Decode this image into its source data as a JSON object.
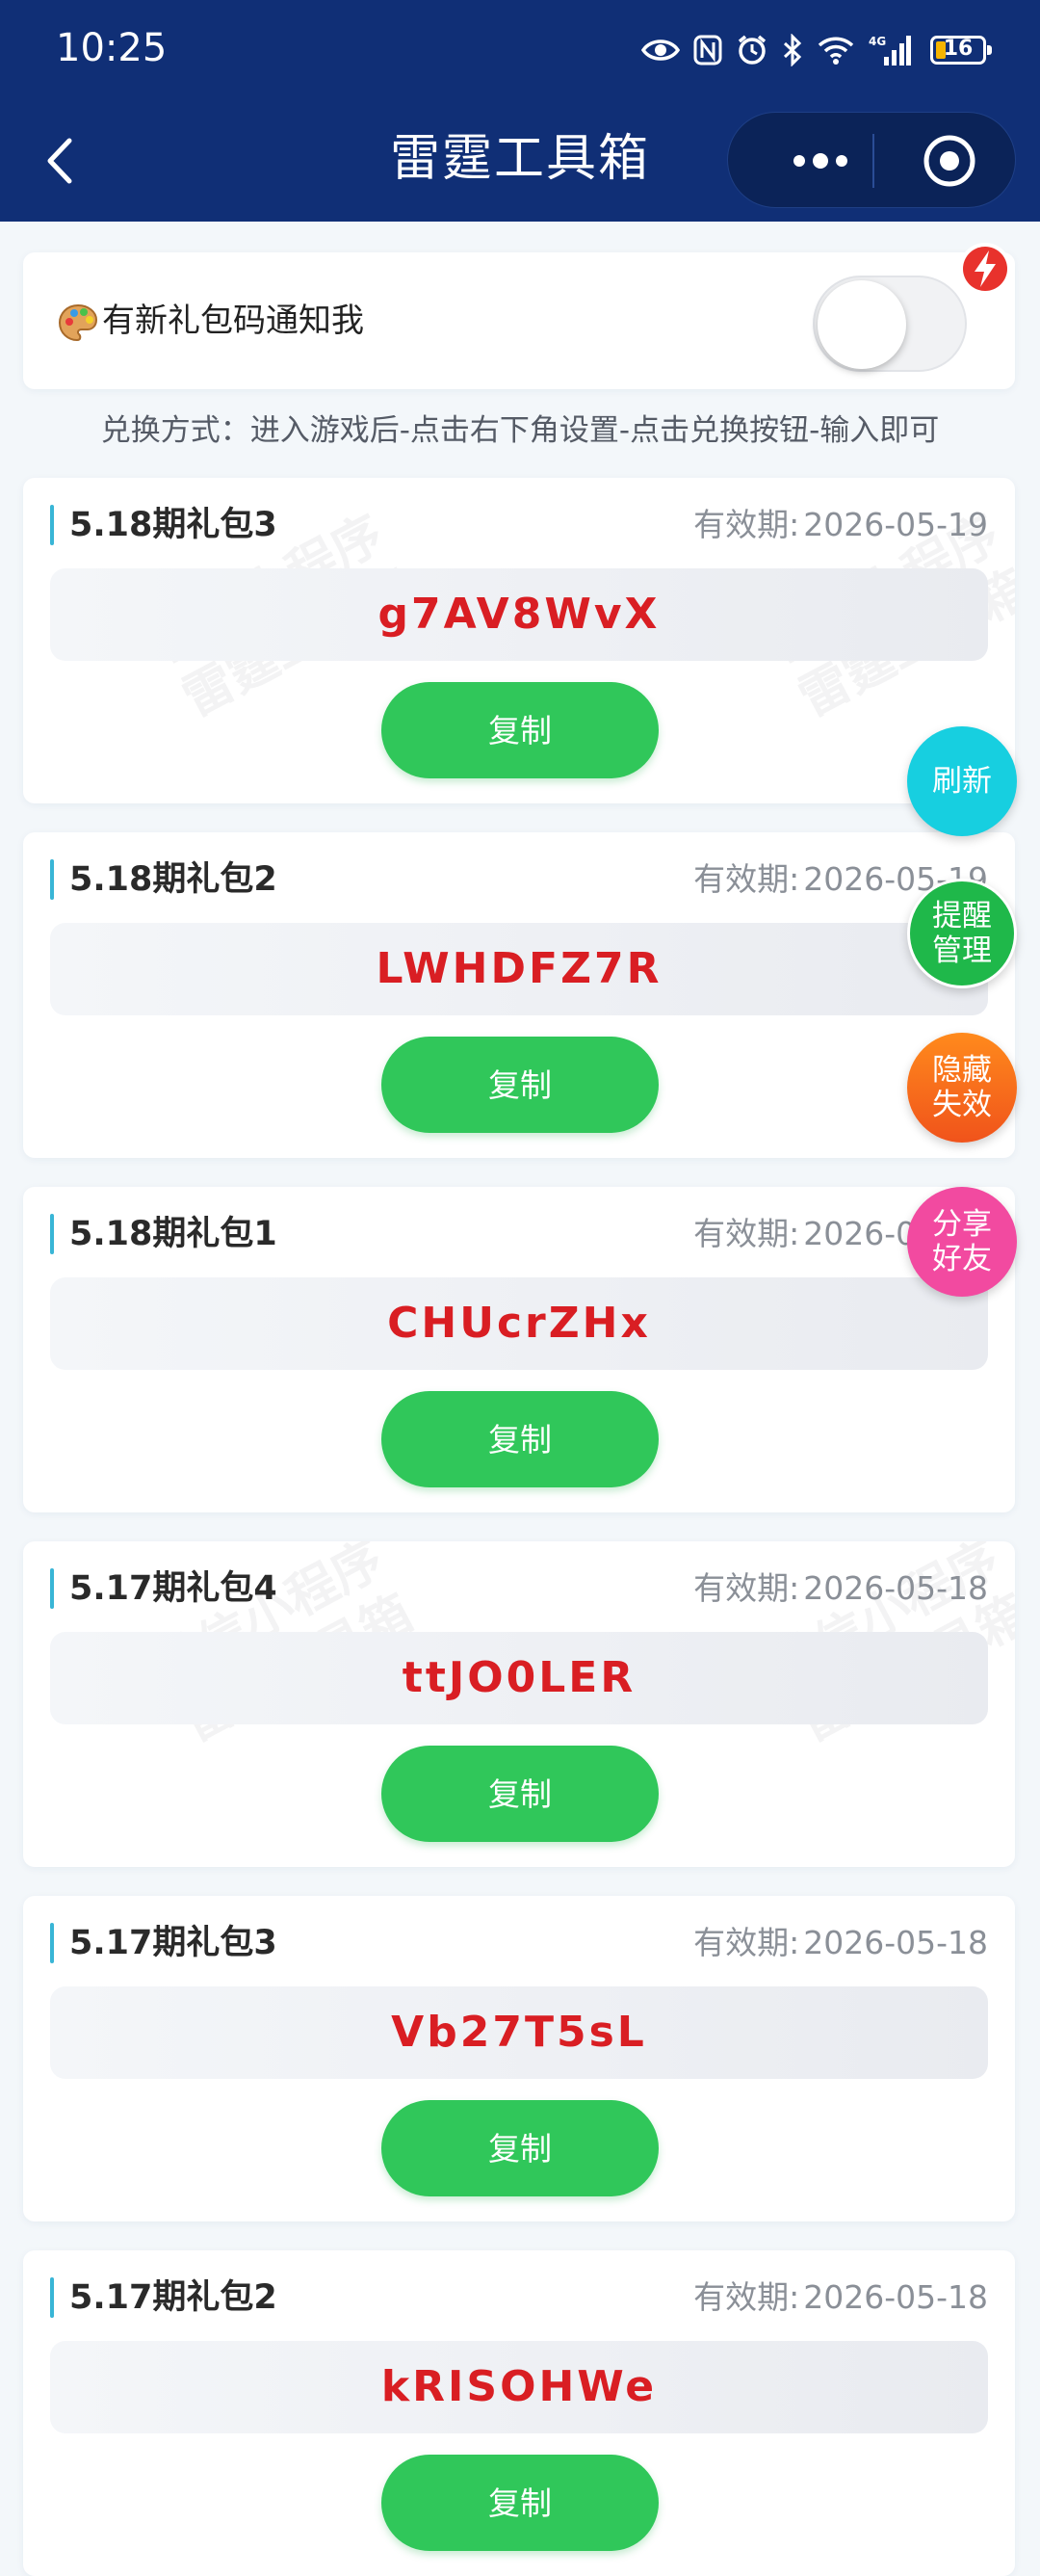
{
  "status_bar": {
    "time": "10:25",
    "battery": "16",
    "icons": [
      "eye-icon",
      "nfc-icon",
      "alarm-icon",
      "bluetooth-icon",
      "wifi-icon",
      "signal-4g-icon",
      "battery-icon"
    ]
  },
  "nav": {
    "title": "雷霆工具箱",
    "back_icon": "chevron-left-icon",
    "more_icon": "more-dots-icon",
    "close_icon": "target-icon"
  },
  "notify": {
    "label": "有新礼包码通知我",
    "toggle_on": false,
    "icon": "palette-icon",
    "badge_icon": "flash-icon"
  },
  "instruction": "兑换方式：进入游戏后-点击右下角设置-点击兑换按钮-输入即可",
  "expire_label": "有效期:",
  "copy_label": "复制",
  "watermark": {
    "line1": "微信小程序",
    "line2": "雷霆工具箱"
  },
  "gifts": [
    {
      "name": "5.18期礼包3",
      "expire": "2026-05-19",
      "code": "g7AV8WvX"
    },
    {
      "name": "5.18期礼包2",
      "expire": "2026-05-19",
      "code": "LWHDFZ7R"
    },
    {
      "name": "5.18期礼包1",
      "expire": "2026-05-19",
      "code": "CHUcrZHx"
    },
    {
      "name": "5.17期礼包4",
      "expire": "2026-05-18",
      "code": "ttJO0LER"
    },
    {
      "name": "5.17期礼包3",
      "expire": "2026-05-18",
      "code": "Vb27T5sL"
    },
    {
      "name": "5.17期礼包2",
      "expire": "2026-05-18",
      "code": "kRISOHWe"
    }
  ],
  "fabs": {
    "refresh": "刷新",
    "remind_1": "提醒",
    "remind_2": "管理",
    "hide_1": "隐藏",
    "hide_2": "失效",
    "share_1": "分享",
    "share_2": "好友"
  },
  "colors": {
    "header": "#102f76",
    "code": "#d91e23",
    "copy_button": "#30c75a",
    "accent": "#39b5d6",
    "fab_refresh": "#17cfe0",
    "fab_remind": "#1fb84a",
    "fab_hide": "#f0531b",
    "fab_share": "#f24aa0"
  }
}
